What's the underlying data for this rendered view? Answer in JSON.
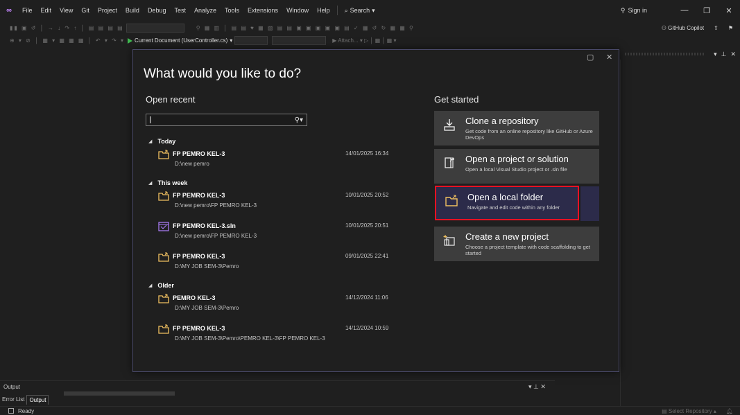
{
  "menubar": {
    "items": [
      "File",
      "Edit",
      "View",
      "Git",
      "Project",
      "Build",
      "Debug",
      "Test",
      "Analyze",
      "Tools",
      "Extensions",
      "Window",
      "Help"
    ],
    "search_label": "Search",
    "sign_in": "Sign in",
    "window_min": "—",
    "window_max": "❐",
    "window_close": "✕"
  },
  "toolbar": {
    "run_target": "Current Document (UserController.cs)",
    "attach_label": "Attach...",
    "copilot_label": "GitHub Copilot"
  },
  "dialog": {
    "title": "What would you like to do?",
    "open_recent": {
      "title": "Open recent",
      "search_value": "",
      "groups": [
        {
          "label": "Today",
          "items": [
            {
              "name": "FP PEMRO KEL-3",
              "path": "D:\\new pemro",
              "date": "14/01/2025 16:34",
              "icon": "folder-icon"
            }
          ]
        },
        {
          "label": "This week",
          "items": [
            {
              "name": "FP PEMRO KEL-3",
              "path": "D:\\new pemro\\FP PEMRO KEL-3",
              "date": "10/01/2025 20:52",
              "icon": "folder-icon"
            },
            {
              "name": "FP PEMRO KEL-3.sln",
              "path": "D:\\new pemro\\FP PEMRO KEL-3",
              "date": "10/01/2025 20:51",
              "icon": "solution-icon"
            },
            {
              "name": "FP PEMRO KEL-3",
              "path": "D:\\MY JOB SEM-3\\Pemro",
              "date": "09/01/2025 22:41",
              "icon": "folder-icon"
            }
          ]
        },
        {
          "label": "Older",
          "items": [
            {
              "name": "PEMRO KEL-3",
              "path": "D:\\MY JOB SEM-3\\Pemro",
              "date": "14/12/2024 11:06",
              "icon": "folder-icon"
            },
            {
              "name": "FP PEMRO KEL-3",
              "path": "D:\\MY JOB SEM-3\\Pemro\\PEMRO KEL-3\\FP PEMRO KEL-3",
              "date": "14/12/2024 10:59",
              "icon": "folder-icon"
            }
          ]
        }
      ]
    },
    "get_started": {
      "title": "Get started",
      "cards": [
        {
          "title": "Clone a repository",
          "desc": "Get code from an online repository like GitHub or Azure DevOps",
          "icon": "clone-icon",
          "highlighted": false
        },
        {
          "title": "Open a project or solution",
          "desc": "Open a local Visual Studio project or .sln file",
          "icon": "open-project-icon",
          "highlighted": false
        },
        {
          "title": "Open a local folder",
          "desc": "Navigate and edit code within any folder",
          "icon": "folder-icon",
          "highlighted": true
        },
        {
          "title": "Create a new project",
          "desc": "Choose a project template with code scaffolding to get started",
          "icon": "new-project-icon",
          "highlighted": false
        }
      ]
    }
  },
  "output_panel": {
    "title": "Output",
    "tabs": [
      "Error List",
      "Output"
    ],
    "active_tab": "Output"
  },
  "statusbar": {
    "ready": "Ready",
    "select_repository": "Select Repository"
  },
  "colors": {
    "accent": "#c586ff",
    "highlight_border": "#e81123",
    "card_bg": "#3d3d3d",
    "card_selected_bg": "#2c2b4a"
  }
}
